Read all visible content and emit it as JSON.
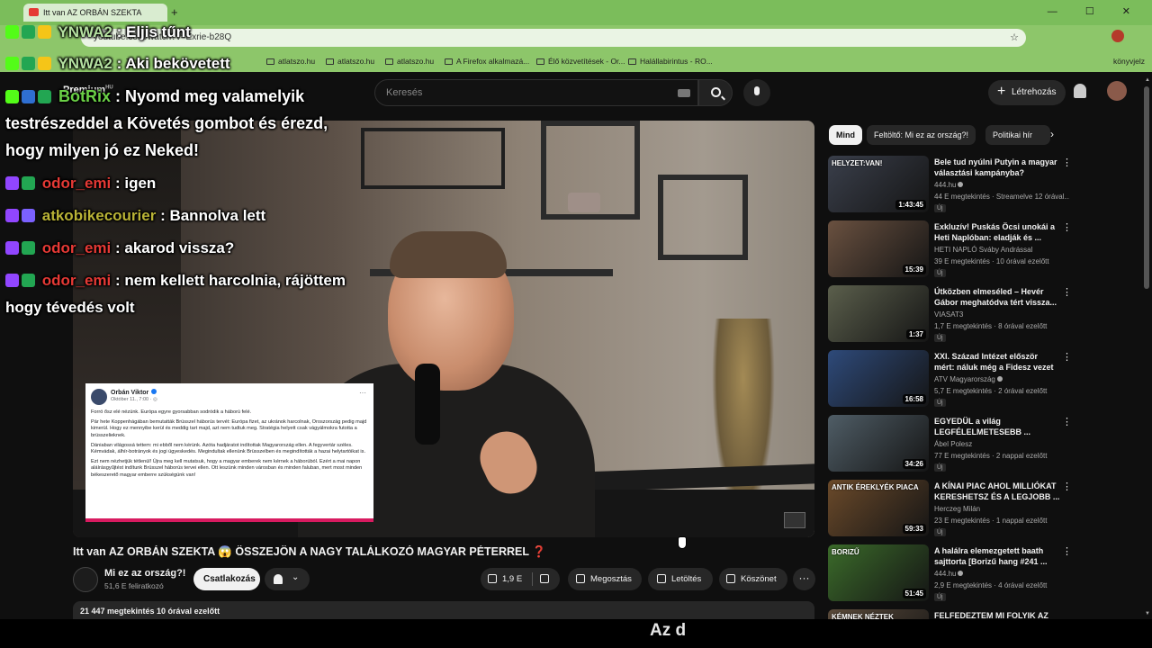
{
  "browser": {
    "tab_title": "Itt van AZ ORBÁN SZEKTA",
    "tab_new": "+",
    "window_controls": "—  ☐  ✕",
    "url": "youtube.com/watch?v=Exrie-b28Q",
    "bookmarks": [
      {
        "label": "Trbe"
      },
      {
        "label": "atlatszo.hu"
      },
      {
        "label": "atlatszo.hu"
      },
      {
        "label": "atlatszo.hu"
      },
      {
        "label": "A Firefox alkalmazá..."
      },
      {
        "label": "Élő közvetítések - Or..."
      },
      {
        "label": "Halállabirintus - RO..."
      }
    ],
    "bookmarks_right": "könyvjelz"
  },
  "youtube": {
    "logo_label": "Premium",
    "logo_region": "HU",
    "search_placeholder": "Keresés",
    "create_label": "Létrehozás"
  },
  "chat": [
    {
      "user": "YNWA2",
      "message": "Eljis tűnt",
      "user_color": "#b4e0a0"
    },
    {
      "user": "YNWA2",
      "message": "Aki bekövetett",
      "user_color": "#b4e0a0"
    },
    {
      "user": "BotRix",
      "message": "Nyomd meg valamelyik",
      "user_color": "#6ad046"
    },
    {
      "user": "",
      "message": "testrészeddel a Követés gombot és érezd,",
      "user_color": ""
    },
    {
      "user": "",
      "message": "hogy milyen jó ez Neked!",
      "user_color": ""
    },
    {
      "user": "odor_emi",
      "message": "igen",
      "user_color": "#e53935"
    },
    {
      "user": "atkobikecourier",
      "message": "Bannolva lett",
      "user_color": "#b9b336"
    },
    {
      "user": "odor_emi",
      "message": "akarod vissza?",
      "user_color": "#e53935"
    },
    {
      "user": "odor_emi",
      "message": "nem kellett harcolnia, rájöttem",
      "user_color": "#e53935"
    },
    {
      "user": "",
      "message": "hogy tévedés volt",
      "user_color": ""
    }
  ],
  "fb_post": {
    "author": "Orbán Viktor",
    "date": "Október 11., 7:00 · ◎",
    "paragraphs": [
      "Forró ősz elé nézünk. Európa egyre gyorsabban sodródik a háború felé.",
      "Pár hete Koppenhágában bemutatták Brüsszel háborús tervét: Európa fizet, az ukránok harcolnak, Oroszország pedig majd kimerül. Hogy ez mennyibe kerül és meddig tart majd, azt nem tudtuk meg. Stratégia helyett csak vágyálmokra futotta a brüsszelieknek.",
      "Dánia­ban világossá tettem: mi ebből nem kérünk. Azóta hadjáratot indítottak Magyarország ellen. A fegyvertár széles. Kémvádak, álhír-botrányok és jogi ügyeskedés. Megindultak ellenünk Brüsszelben és megindították a hazai helytartóikat is.",
      "Ezt nem nézhetjük tétlenül! Újra meg kell mutatsuk, hogy a magyar emberek  nem kérnek a háborúból. Ezért a mai napon aláírásgyűjtést indítunk Brüsszel háborús tervei ellen. Ott leszünk minden városban és minden faluban, mert most minden békeszerető magyar emberre szükségünk van!"
    ]
  },
  "video": {
    "title": "Itt van AZ ORBÁN SZEKTA 😱 ÖSSZEJÖN A NAGY TALÁLKOZÓ MAGYAR PÉTERREL ❓",
    "channel": "Mi ez az ország?!",
    "subscribers": "51,6 E feliratkozó",
    "join_label": "Csatlakozás",
    "likes": "1,9 E",
    "share_label": "Megosztás",
    "download_label": "Letöltés",
    "thanks_label": "Köszönet",
    "more_label": "···",
    "views_line": "21 447 megtekintés  10 órával ezelőtt",
    "caption": "Az d"
  },
  "chips": [
    "Mind",
    "Feltöltő: Mi ez az ország?!",
    "Politikai hír"
  ],
  "recommendations": [
    {
      "title": "Bele tud nyúlni Putyin a magyar választási kampányba?",
      "channel": "444.hu",
      "verified": true,
      "meta": "44 E megtekintés · Streamelve 12 órával...",
      "new": "Új",
      "duration": "1:43:45",
      "thumb_text": "HELYZET:VAN!",
      "thumb_color": "#3a3f4b"
    },
    {
      "title": "Exkluzív! Puskás Öcsi unokái a Heti Naplóban: eladják és ...",
      "channel": "HETI NAPLÓ Sváby Andrással",
      "verified": false,
      "meta": "39 E megtekintés · 10 órával ezelőtt",
      "new": "Új",
      "duration": "15:39",
      "thumb_text": "",
      "thumb_color": "#6a5140"
    },
    {
      "title": "Útközben elmeséled – Hevér Gábor meghatódva tért vissza...",
      "channel": "VIASAT3",
      "verified": false,
      "meta": "1,7 E megtekintés · 8 órával ezelőtt",
      "new": "Új",
      "duration": "1:37",
      "thumb_text": "",
      "thumb_color": "#5b5f4c"
    },
    {
      "title": "XXI. Század Intézet először mért: náluk még a Fidesz vezet",
      "channel": "ATV Magyarország",
      "verified": true,
      "meta": "5,7 E megtekintés · 2 órával ezelőtt",
      "new": "Új",
      "duration": "16:58",
      "thumb_text": "",
      "thumb_color": "#2e4a7a"
    },
    {
      "title": "EGYEDÜL a világ LEGFÉLELMETESEBB ...",
      "channel": "Ábel Polesz",
      "verified": false,
      "meta": "77 E megtekintés · 2 nappal ezelőtt",
      "new": "Új",
      "duration": "34:26",
      "thumb_text": "",
      "thumb_color": "#4f5d66"
    },
    {
      "title": "A KÍNAI PIAC AHOL MILLIÓKAT KERESHETSZ ÉS A LEGJOBB ...",
      "channel": "Herczeg Milán",
      "verified": false,
      "meta": "23 E megtekintés · 1 nappal ezelőtt",
      "new": "Új",
      "duration": "59:33",
      "thumb_text": "ANTIK ÉREKLYÉK PIACA",
      "thumb_color": "#6b4a2a"
    },
    {
      "title": "A halálra elemezgetett baath sajttorta [Borizű hang #241 ...",
      "channel": "444.hu",
      "verified": true,
      "meta": "2,9 E megtekintés · 4 órával ezelőtt",
      "new": "Új",
      "duration": "51:45",
      "thumb_text": "BORIZŰ",
      "thumb_color": "#3b6b2a"
    },
    {
      "title": "FELFEDEZTEM MI FOLYIK AZ",
      "channel": "",
      "verified": false,
      "meta": "",
      "new": "",
      "duration": "",
      "thumb_text": "KÉMNEK NÉZTEK",
      "thumb_color": "#5a4a3a"
    }
  ]
}
